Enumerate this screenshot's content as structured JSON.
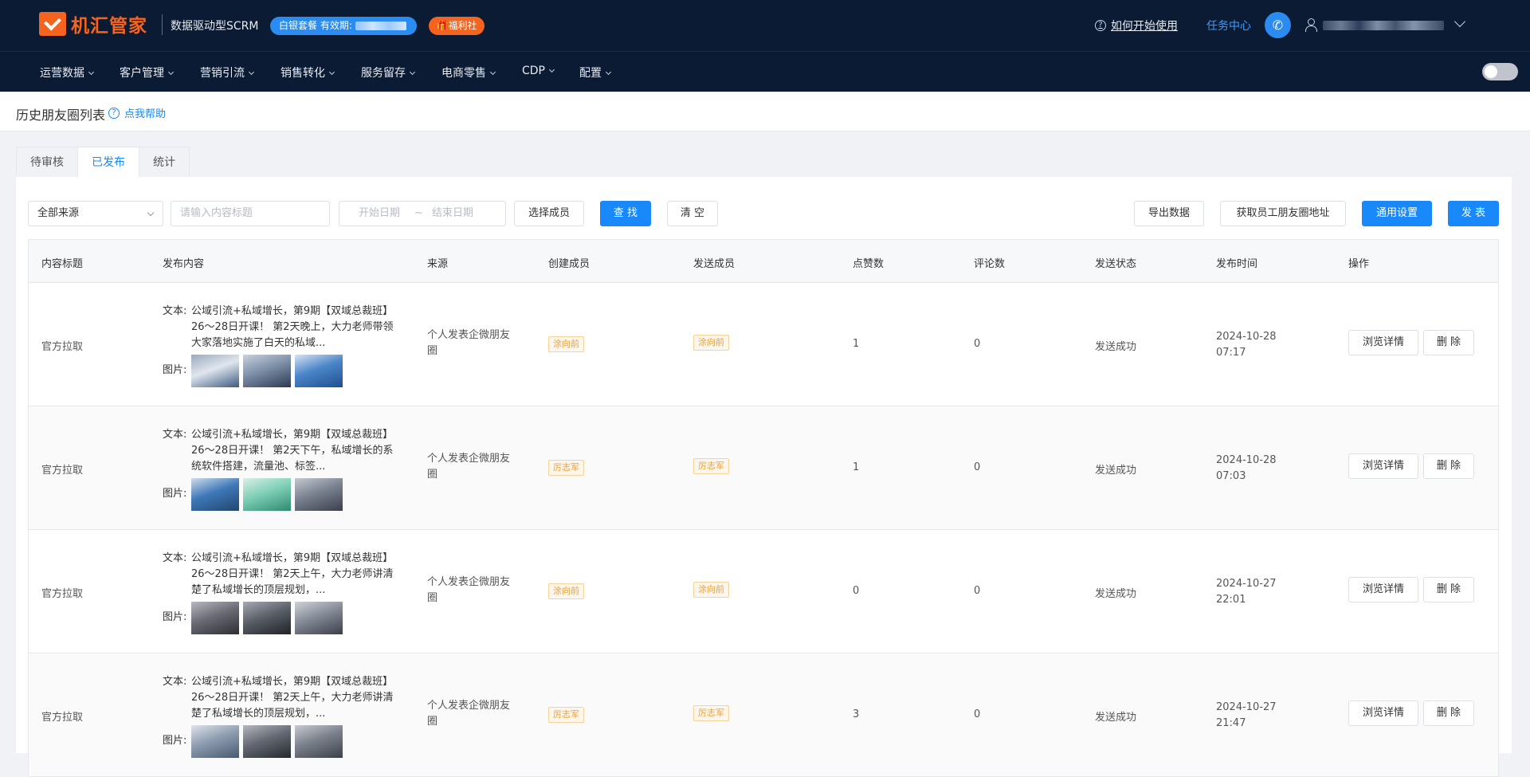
{
  "header": {
    "logo_text": "机汇管家",
    "subtitle": "数据驱动型SCRM",
    "package_badge": "白银套餐 有效期:",
    "welfare_badge": "福利社",
    "help_link": "如何开始使用",
    "task_center": "任务中心"
  },
  "nav": {
    "items": [
      "运营数据",
      "客户管理",
      "营销引流",
      "销售转化",
      "服务留存",
      "电商零售",
      "CDP",
      "配置"
    ]
  },
  "page": {
    "title": "历史朋友圈列表",
    "help": "点我帮助"
  },
  "tabs": [
    "待审核",
    "已发布",
    "统计"
  ],
  "active_tab": "已发布",
  "filters": {
    "source_select": "全部来源",
    "title_placeholder": "请输入内容标题",
    "start_date_placeholder": "开始日期",
    "range_sep": "~",
    "end_date_placeholder": "结束日期",
    "select_member": "选择成员",
    "search": "查 找",
    "clear": "清 空",
    "export": "导出数据",
    "get_address": "获取员工朋友圈地址",
    "general_settings": "通用设置",
    "publish": "发 表"
  },
  "table": {
    "columns": [
      "内容标题",
      "发布内容",
      "来源",
      "创建成员",
      "发送成员",
      "点赞数",
      "评论数",
      "发送状态",
      "发布时间",
      "操作"
    ],
    "text_label": "文本:",
    "image_label": "图片:",
    "view_detail": "浏览详情",
    "delete": "删 除",
    "rows": [
      {
        "title": "官方拉取",
        "text": "公域引流+私域增长，第9期【双域总裁班】26～28日开课！ 第2天晚上，大力老师带领大家落地实施了白天的私域...",
        "source": "个人发表企微朋友圈",
        "creator": "涂向前",
        "sender": "涂向前",
        "likes": "1",
        "comments": "0",
        "status": "发送成功",
        "date": "2024-10-28",
        "time": "07:17"
      },
      {
        "title": "官方拉取",
        "text": "公域引流+私域增长，第9期【双域总裁班】26～28日开课！ 第2天下午，私域增长的系统软件搭建，流量池、标签...",
        "source": "个人发表企微朋友圈",
        "creator": "厉志军",
        "sender": "厉志军",
        "likes": "1",
        "comments": "0",
        "status": "发送成功",
        "date": "2024-10-28",
        "time": "07:03"
      },
      {
        "title": "官方拉取",
        "text": "公域引流+私域增长，第9期【双域总裁班】26～28日开课！ 第2天上午，大力老师讲清楚了私域增长的顶层规划，...",
        "source": "个人发表企微朋友圈",
        "creator": "涂向前",
        "sender": "涂向前",
        "likes": "0",
        "comments": "0",
        "status": "发送成功",
        "date": "2024-10-27",
        "time": "22:01"
      },
      {
        "title": "官方拉取",
        "text": "公域引流+私域增长，第9期【双域总裁班】26～28日开课！ 第2天上午，大力老师讲清楚了私域增长的顶层规划，...",
        "source": "个人发表企微朋友圈",
        "creator": "厉志军",
        "sender": "厉志军",
        "likes": "3",
        "comments": "0",
        "status": "发送成功",
        "date": "2024-10-27",
        "time": "21:47"
      }
    ]
  },
  "colors": {
    "header_bg": "#0b1b33",
    "brand_orange": "#f5641e",
    "primary_blue": "#1989fa",
    "tag_orange": "#e6a23c"
  }
}
